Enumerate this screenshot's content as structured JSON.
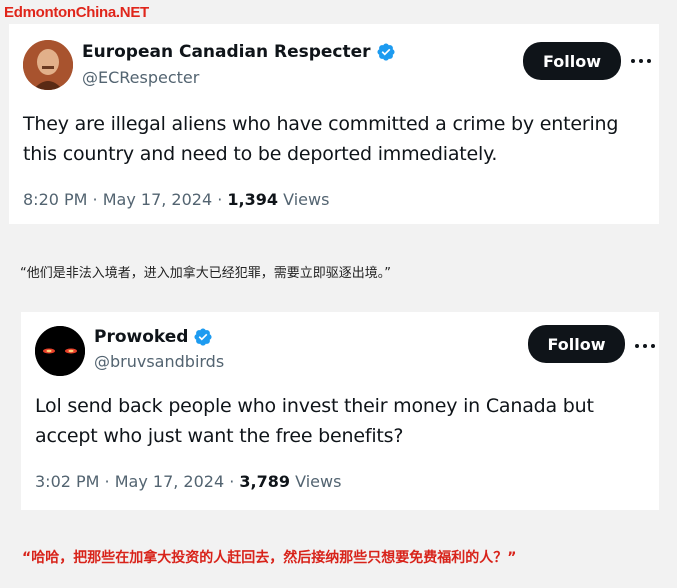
{
  "site": {
    "logo_text": "EdmontonChina.NET"
  },
  "tweets": [
    {
      "display_name": "European Canadian Respecter",
      "handle": "@ECRespecter",
      "follow_label": "Follow",
      "text": "They are illegal aliens who have committed a crime by entering this country and need to be deported immediately.",
      "time": "8:20 PM · May 17, 2024 · ",
      "views_count": "1,394",
      "views_label": " Views",
      "verified": true
    },
    {
      "display_name": "Prowoked",
      "handle": "@bruvsandbirds",
      "follow_label": "Follow",
      "text": "Lol send back people who invest their money in Canada but accept who just want the free benefits?",
      "time": "3:02 PM · May 17, 2024 · ",
      "views_count": "3,789",
      "views_label": " Views",
      "verified": true
    }
  ],
  "captions": [
    "“他们是非法入境者，进入加拿大已经犯罪，需要立即驱逐出境。”",
    "“哈哈，把那些在加拿大投资的人赶回去，然后接纳那些只想要免费福利的人？”"
  ],
  "colors": {
    "verified": "#1d9bf0",
    "follow_bg": "#0f1419",
    "caption_highlight": "#d8231a",
    "logo": "#e0261b"
  },
  "icons": {
    "verified": "verified-badge-icon",
    "more": "more-horizontal-icon"
  }
}
